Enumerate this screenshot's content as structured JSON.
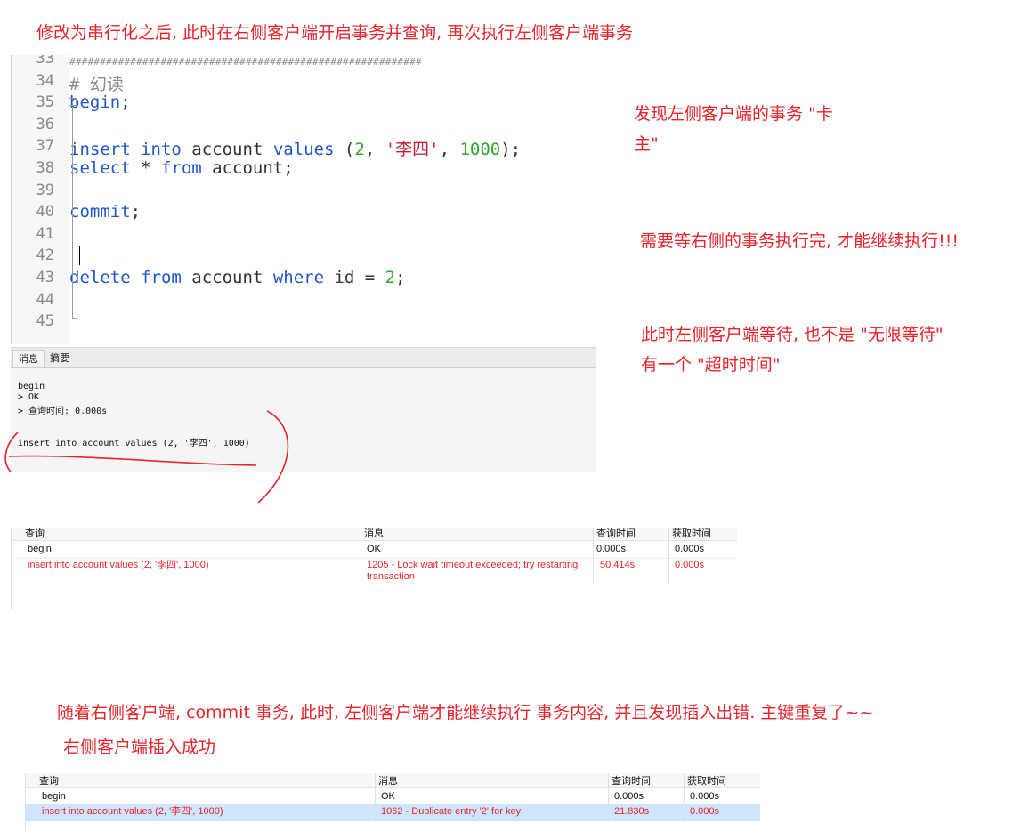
{
  "notes": {
    "top": "修改为串行化之后, 此时在右侧客户端开启事务并查询, 再次执行左侧客户端事务",
    "stuck": "发现左侧客户端的事务 \"卡\n主\"",
    "wait_right": "需要等右侧的事务执行完, 才能继续执行!!!",
    "timeout": "此时左侧客户端等待, 也不是 \"无限等待\"\n有一个 \"超时时间\"",
    "after_commit": "随着右侧客户端, commit 事务, 此时, 左侧客户端才能继续执行 事务内容, 并且发现插入出错. 主键重复了~~",
    "right_success": "右侧客户端插入成功"
  },
  "editor": {
    "lines": [
      {
        "n": "33",
        "text": "##########################################################"
      },
      {
        "n": "34",
        "text": "# 幻读"
      },
      {
        "n": "35",
        "text": "begin;"
      },
      {
        "n": "36",
        "text": ""
      },
      {
        "n": "37",
        "text": "insert into account values (2, '李四', 1000);"
      },
      {
        "n": "38",
        "text": "select * from account;"
      },
      {
        "n": "39",
        "text": ""
      },
      {
        "n": "40",
        "text": "commit;"
      },
      {
        "n": "41",
        "text": ""
      },
      {
        "n": "42",
        "text": ""
      },
      {
        "n": "43",
        "text": "delete from account where id = 2;"
      },
      {
        "n": "44",
        "text": ""
      },
      {
        "n": "45",
        "text": ""
      }
    ],
    "colors": {
      "keyword": "#1f57c8",
      "number": "#2fa52f",
      "string": "#c2243a"
    }
  },
  "msg_panel": {
    "tabs": [
      "消息",
      "摘要"
    ],
    "lines": [
      "begin",
      "> OK",
      "> 查询时间: 0.000s",
      "",
      "insert into account values (2, '李四', 1000)"
    ]
  },
  "table1": {
    "headers": [
      "查询",
      "消息",
      "查询时间",
      "获取时间"
    ],
    "rows": [
      [
        "begin",
        "OK",
        "0.000s",
        "0.000s"
      ],
      [
        "insert into account values (2, '李四', 1000)",
        "1205 - Lock wait timeout exceeded; try restarting\ntransaction",
        "50.414s",
        "0.000s"
      ]
    ]
  },
  "table2": {
    "headers": [
      "查询",
      "消息",
      "查询时间",
      "获取时间"
    ],
    "rows": [
      [
        "begin",
        "OK",
        "0.000s",
        "0.000s"
      ],
      [
        "insert into account values (2, '李四', 1000)",
        "1062 - Duplicate entry '2' for key",
        "21.830s",
        "0.000s"
      ]
    ]
  },
  "accent_color": "#e8232a"
}
